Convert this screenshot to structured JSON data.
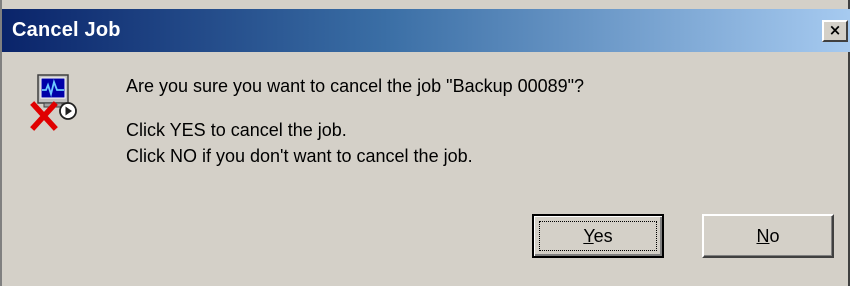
{
  "window": {
    "title": "Cancel Job",
    "close_glyph": "×"
  },
  "message": {
    "question": "Are you sure you want to cancel the job \"Backup 00089\"?",
    "line_yes": "Click YES to cancel the job.",
    "line_no": "Click NO if you don't want to cancel the job."
  },
  "buttons": {
    "yes": {
      "mnemonic": "Y",
      "rest": "es"
    },
    "no": {
      "mnemonic": "N",
      "rest": "o"
    }
  },
  "icons": {
    "main": "cancel-job-icon"
  },
  "colors": {
    "titlebar_start": "#0a246a",
    "titlebar_end": "#a6caf0",
    "dialog_face": "#d4d0c8"
  }
}
